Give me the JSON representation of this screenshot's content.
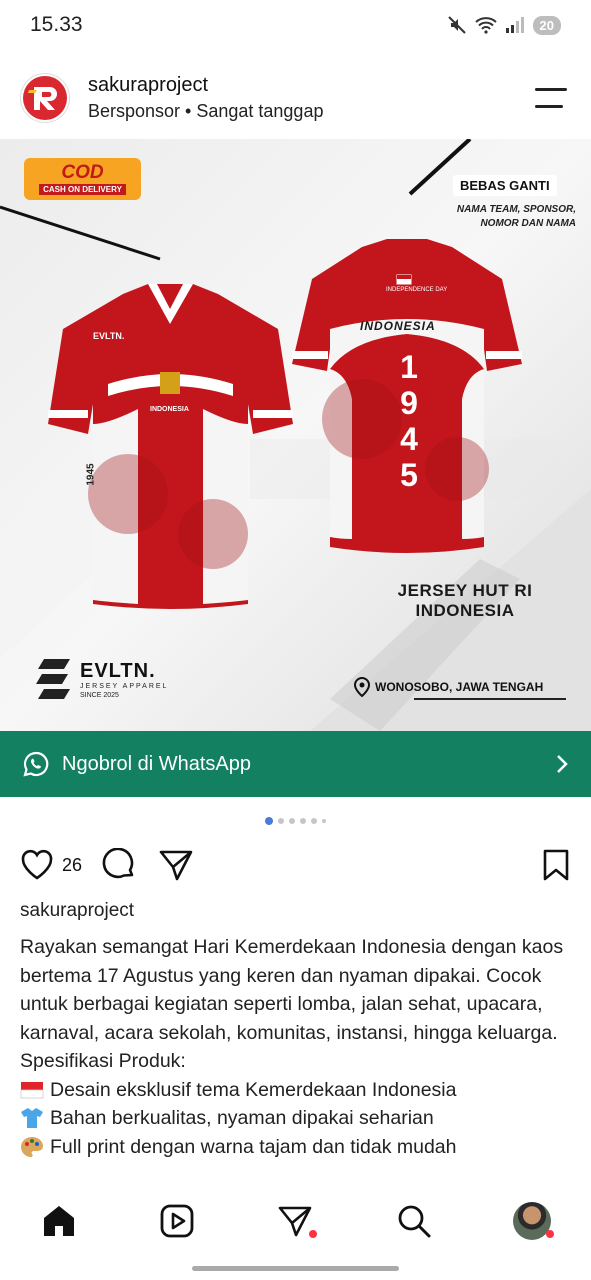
{
  "status_bar": {
    "time": "15.33",
    "battery": "20"
  },
  "post": {
    "username": "sakuraproject",
    "sponsor_line": "Bersponsor • Sangat tanggap",
    "logo_text": "R"
  },
  "ad": {
    "cod_title": "COD",
    "cod_sub": "CASH ON DELIVERY",
    "bebas_ganti": "BEBAS GANTI",
    "nama_team": "NAMA TEAM, SPONSOR, NOMOR DAN NAMA",
    "jersey_caption_1": "JERSEY HUT RI",
    "jersey_caption_2": "INDONESIA",
    "brand_name": "EVLTN.",
    "brand_sub": "JERSEY APPAREL",
    "brand_since": "SINCE 2025",
    "location": "WONOSOBO, JAWA TENGAH",
    "jersey_front_brand": "EVLTN.",
    "jersey_front_text": "INDONESIA",
    "jersey_year": "1945",
    "jersey_back_text": "INDONESIA",
    "jersey_back_number": "1945",
    "jersey_back_small": "INDEPENDENCE DAY"
  },
  "cta": {
    "label": "Ngobrol di WhatsApp"
  },
  "carousel": {
    "count": 6,
    "active": 0
  },
  "actions": {
    "likes": "26"
  },
  "caption": {
    "username": "sakuraproject",
    "body": "Rayakan semangat Hari Kemerdekaan Indonesia dengan kaos bertema 17 Agustus yang keren dan nyaman dipakai. Cocok untuk berbagai kegiatan seperti lomba, jalan sehat, upacara, karnaval, acara sekolah, komunitas, instansi, hingga keluarga.",
    "spec_title": "Spesifikasi Produk:",
    "specs": [
      {
        "icon": "indonesia-flag-icon",
        "text": "Desain eksklusif tema Kemerdekaan Indonesia"
      },
      {
        "icon": "tshirt-icon",
        "text": "Bahan berkualitas, nyaman dipakai seharian"
      },
      {
        "icon": "palette-icon",
        "text": "Full print dengan warna tajam dan tidak mudah"
      }
    ]
  },
  "colors": {
    "whatsapp_green": "#128061",
    "jersey_red": "#c3161c",
    "notif_red": "#ff3040",
    "dot_active": "#4a7bd8"
  }
}
